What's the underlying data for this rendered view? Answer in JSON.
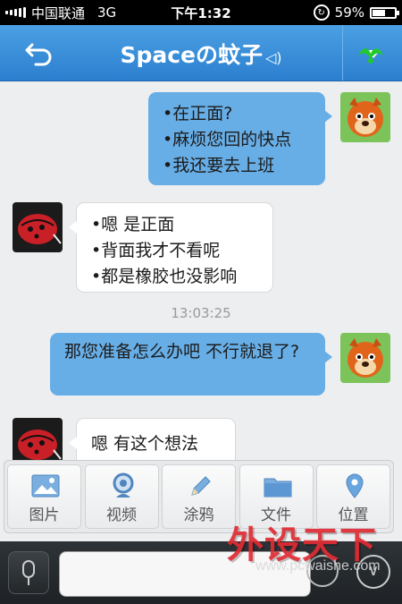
{
  "status_bar": {
    "carrier": "中国联通",
    "network": "3G",
    "time": "下午1:32",
    "battery_text": "59%",
    "battery_level": 0.59
  },
  "header": {
    "title": "Spaceの蚊子",
    "back_icon": "back-arrow-icon",
    "speaker_icon": "speaker-icon",
    "menu_icon": "dropdown-menu-icon"
  },
  "messages": [
    {
      "direction": "out",
      "lines": [
        "•在正面?",
        "•麻烦您回的快点",
        "•我还要去上班"
      ]
    },
    {
      "direction": "in",
      "lines": [
        "•嗯 是正面",
        "•背面我才不看呢",
        "•都是橡胶也没影响"
      ]
    },
    {
      "direction": "timestamp",
      "text": "13:03:25"
    },
    {
      "direction": "out",
      "lines": [
        "那您准备怎么办吧 不行就退了?"
      ]
    },
    {
      "direction": "in",
      "lines": [
        "嗯 有这个想法"
      ]
    }
  ],
  "toolbar": {
    "items": [
      {
        "label": "图片",
        "icon": "image-icon"
      },
      {
        "label": "视频",
        "icon": "video-icon"
      },
      {
        "label": "涂鸦",
        "icon": "pencil-icon"
      },
      {
        "label": "文件",
        "icon": "folder-icon"
      },
      {
        "label": "位置",
        "icon": "location-pin-icon"
      }
    ]
  },
  "input_bar": {
    "voice_icon": "microphone-icon",
    "text_value": "",
    "emoji_icon": "emoji-icon",
    "more_icon": "chevron-down-icon"
  },
  "watermark": {
    "text": "外设天下",
    "url": "www.pcwaishe.com"
  },
  "colors": {
    "header": "#3a8fd9",
    "outgoing_bubble": "#68aee6",
    "incoming_bubble": "#ffffff",
    "watermark": "#e02b33"
  }
}
